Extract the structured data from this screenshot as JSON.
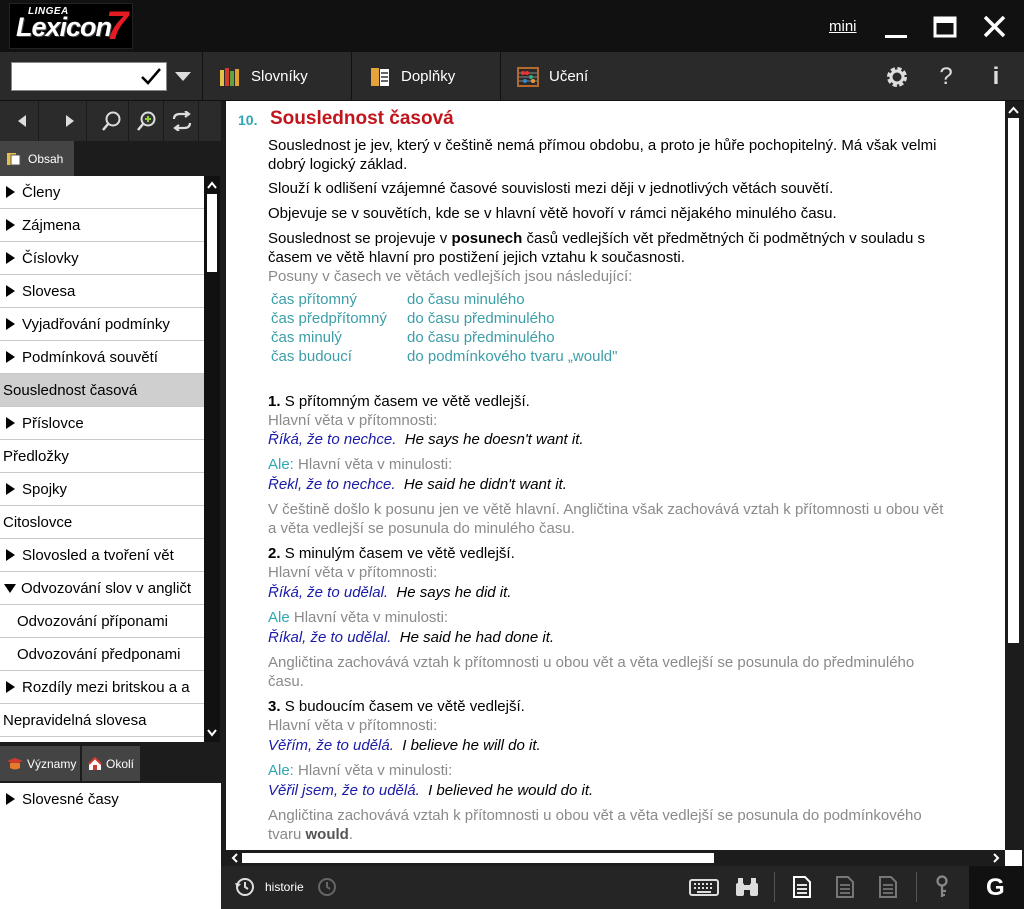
{
  "window": {
    "logo_brand": "LINGEA",
    "logo_name": "Lexicon",
    "logo_version": "7",
    "mini_label": "mini"
  },
  "toolbar": {
    "search_value": "",
    "dictionaries_label": "Slovníky",
    "addons_label": "Doplňky",
    "learning_label": "Učení",
    "help_label": "?",
    "info_label": "i"
  },
  "sidebar": {
    "tab_contents": "Obsah",
    "toc": [
      {
        "label": "Členy",
        "arrow": "right"
      },
      {
        "label": "Zájmena",
        "arrow": "right"
      },
      {
        "label": "Číslovky",
        "arrow": "right"
      },
      {
        "label": "Slovesa",
        "arrow": "right"
      },
      {
        "label": "Vyjadřování podmínky",
        "arrow": "right"
      },
      {
        "label": "Podmínková souvětí",
        "arrow": "right"
      },
      {
        "label": "Souslednost časová",
        "arrow": "none",
        "selected": true
      },
      {
        "label": "Příslovce",
        "arrow": "right"
      },
      {
        "label": "Předložky",
        "arrow": "none"
      },
      {
        "label": "Spojky",
        "arrow": "right"
      },
      {
        "label": "Citoslovce",
        "arrow": "none"
      },
      {
        "label": "Slovosled a tvoření vět",
        "arrow": "right"
      },
      {
        "label": "Odvozování slov v angličt",
        "arrow": "down"
      },
      {
        "label": "Odvozování příponami",
        "arrow": "sub"
      },
      {
        "label": "Odvozování předponami",
        "arrow": "sub"
      },
      {
        "label": "Rozdíly mezi britskou a a",
        "arrow": "right"
      },
      {
        "label": "Nepravidelná slovesa",
        "arrow": "none"
      }
    ],
    "tab_meanings": "Významy",
    "tab_surroundings": "Okolí",
    "meanings_item": "Slovesné časy"
  },
  "article": {
    "number": "10.",
    "title": "Souslednost časová",
    "p1a": "Souslednost je jev, který v češtině nemá přímou obdobu, a proto je hůře pochopitelný. Má však velmi",
    "p1b": "dobrý logický základ.",
    "p2": "Slouží k odlišení vzájemné časové souvislosti mezi ději v jednotlivých větách souvětí.",
    "p3": "Objevuje se v souvětích, kde se v hlavní větě hovoří v rámci nějakého minulého času.",
    "p4a_pre": "Souslednost se projevuje v ",
    "p4a_bold": "posunech",
    "p4a_post": " časů vedlejších vět předmětných či podmětných v souladu s",
    "p4b": "časem ve větě hlavní pro postižení jejich vztahu k současnosti.",
    "p5": "Posuny v časech ve větách vedlejších jsou následující:",
    "shifts": [
      {
        "from": "čas přítomný",
        "to": "do času minulého"
      },
      {
        "from": "čas předpřítomný",
        "to": "do času předminulého"
      },
      {
        "from": "čas minulý",
        "to": "do času předminulého"
      },
      {
        "from": "čas budoucí",
        "to": "do podmínkového tvaru „would\""
      }
    ],
    "s1_num": "1.",
    "s1_title": "S přítomným časem ve větě vedlejší.",
    "s1_h1": "Hlavní věta v přítomnosti:",
    "s1_cz1": "Říká, že to nechce.",
    "s1_en1": "He says he doesn't want it.",
    "s1_ale": "Ale:",
    "s1_h2": " Hlavní věta v minulosti:",
    "s1_cz2": "Řekl, že to nechce.",
    "s1_en2": "He said he didn't want it.",
    "s1_note_a": "V češtině došlo k posunu jen ve větě hlavní. Angličtina však zachovává vztah k přítomnosti u obou vět",
    "s1_note_b": "a věta vedlejší se posunula do minulého času.",
    "s2_num": "2.",
    "s2_title": "S minulým časem ve větě vedlejší.",
    "s2_h1": "Hlavní věta v přítomnosti:",
    "s2_cz1": "Říká, že to udělal.",
    "s2_en1": "He says he did it.",
    "s2_ale": "Ale",
    "s2_h2": " Hlavní věta v minulosti:",
    "s2_cz2": "Říkal, že to udělal.",
    "s2_en2": "He said he had done it.",
    "s2_note_a": "Angličtina zachovává vztah k přítomnosti u obou vět a věta vedlejší se posunula do předminulého",
    "s2_note_b": "času.",
    "s3_num": "3.",
    "s3_title": "S budoucím časem ve větě vedlejší.",
    "s3_h1": "Hlavní věta v přítomnosti:",
    "s3_cz1": "Věřím, že to udělá.",
    "s3_en1": "I believe he will do it.",
    "s3_ale": "Ale:",
    "s3_h2": " Hlavní věta v minulosti:",
    "s3_cz2": "Věřil jsem, že to udělá.",
    "s3_en2": "I believed he would do it.",
    "s3_note_a": "Angličtina zachovává vztah k přítomnosti u obou vět a věta vedlejší se posunula do podmínkového",
    "s3_note_b_pre": "tvaru ",
    "s3_note_b_bold": "would",
    "s3_note_b_post": "."
  },
  "statusbar": {
    "history_label": "historie"
  },
  "colors": {
    "title_red": "#c0151c",
    "number_teal": "#2ea7b5",
    "example_blue": "#1a1aa8"
  }
}
